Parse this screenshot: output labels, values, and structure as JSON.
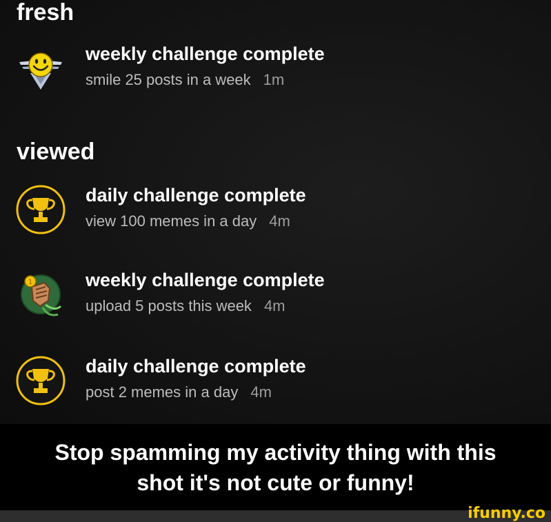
{
  "sections": {
    "fresh_label": "fresh",
    "viewed_label": "viewed"
  },
  "fresh_items": [
    {
      "title": "weekly challenge complete",
      "subtitle": "smile 25 posts in a week",
      "time": "1m",
      "icon": "smile-badge-icon"
    }
  ],
  "viewed_items": [
    {
      "title": "daily challenge complete",
      "subtitle": "view 100 memes in a day",
      "time": "4m",
      "icon": "trophy-icon"
    },
    {
      "title": "weekly challenge complete",
      "subtitle": "upload 5 posts this week",
      "time": "4m",
      "icon": "medal-fist-icon"
    },
    {
      "title": "daily challenge complete",
      "subtitle": "post 2 memes in a day",
      "time": "4m",
      "icon": "trophy-icon"
    }
  ],
  "caption": {
    "line1": "Stop spamming my activity thing with this",
    "line2": "shot it's not cute or funny!"
  },
  "watermark": "ifunny.co",
  "colors": {
    "accent_yellow": "#f2c10f",
    "background": "#141414"
  }
}
